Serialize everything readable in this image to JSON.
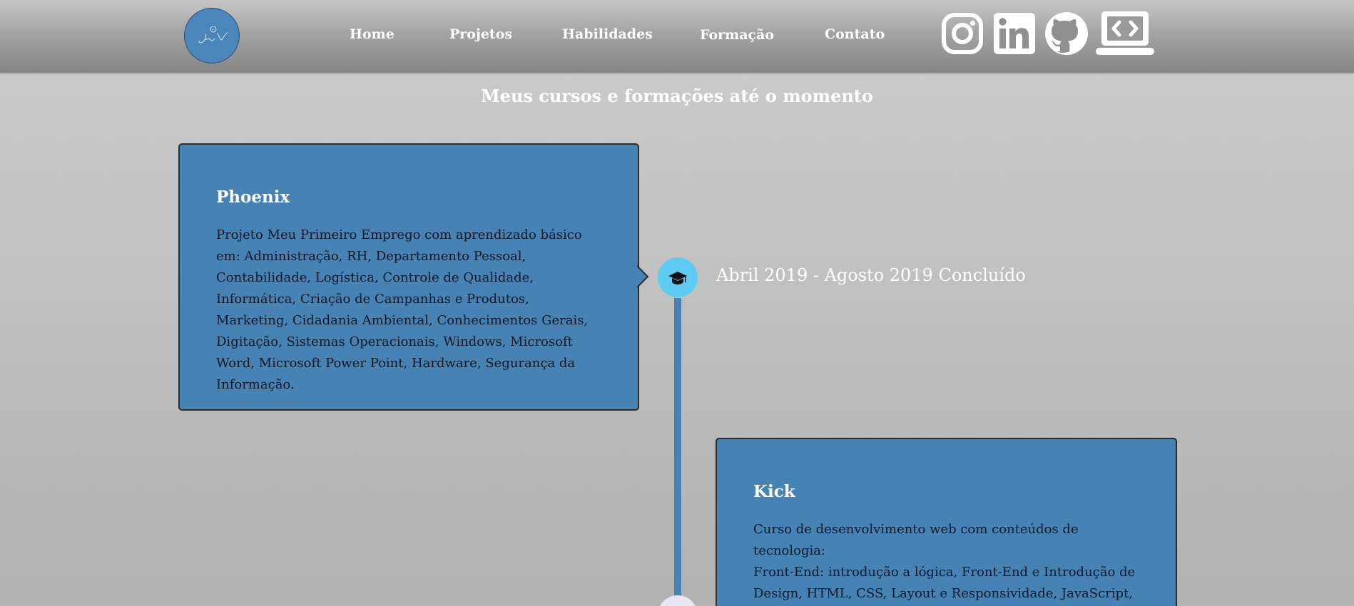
{
  "header": {
    "logo_text": "JoãoVi",
    "nav": [
      {
        "label": "Home"
      },
      {
        "label": "Projetos"
      },
      {
        "label": "Habilidades"
      },
      {
        "label": "Formação"
      },
      {
        "label": "Contato"
      }
    ],
    "social_icons": [
      "instagram-icon",
      "linkedin-icon",
      "github-icon",
      "portfolio-laptop-icon"
    ]
  },
  "page": {
    "title": "Meus cursos e formações até o momento"
  },
  "timeline": [
    {
      "title": "Phoenix",
      "description": "Projeto Meu Primeiro Emprego com aprendizado básico em: Administração, RH, Departamento Pessoal, Contabilidade, Logística, Controle de Qualidade, Informática, Criação de Campanhas e Produtos, Marketing, Cidadania Ambiental, Conhecimentos Gerais, Digitação, Sistemas Operacionais, Windows, Microsoft Word, Microsoft Power Point, Hardware, Segurança da Informação.",
      "date": "Abril 2019 - Agosto 2019 Concluído",
      "icon": "graduation-cap-icon"
    },
    {
      "title": "Kick",
      "description_lines": [
        "Curso de desenvolvimento web com conteúdos de tecnologia:",
        "Front-End: introdução a lógica, Front-End e Introdução de Design, HTML, CSS, Layout e Responsividade, JavaScript,"
      ],
      "icon": "graduation-cap-icon"
    }
  ],
  "colors": {
    "card": "#4682b4",
    "timeline": "#4682b4",
    "active_dot": "#5ecbf3",
    "inactive_dot": "#e7e7f3",
    "text_white": "#ffffff"
  }
}
